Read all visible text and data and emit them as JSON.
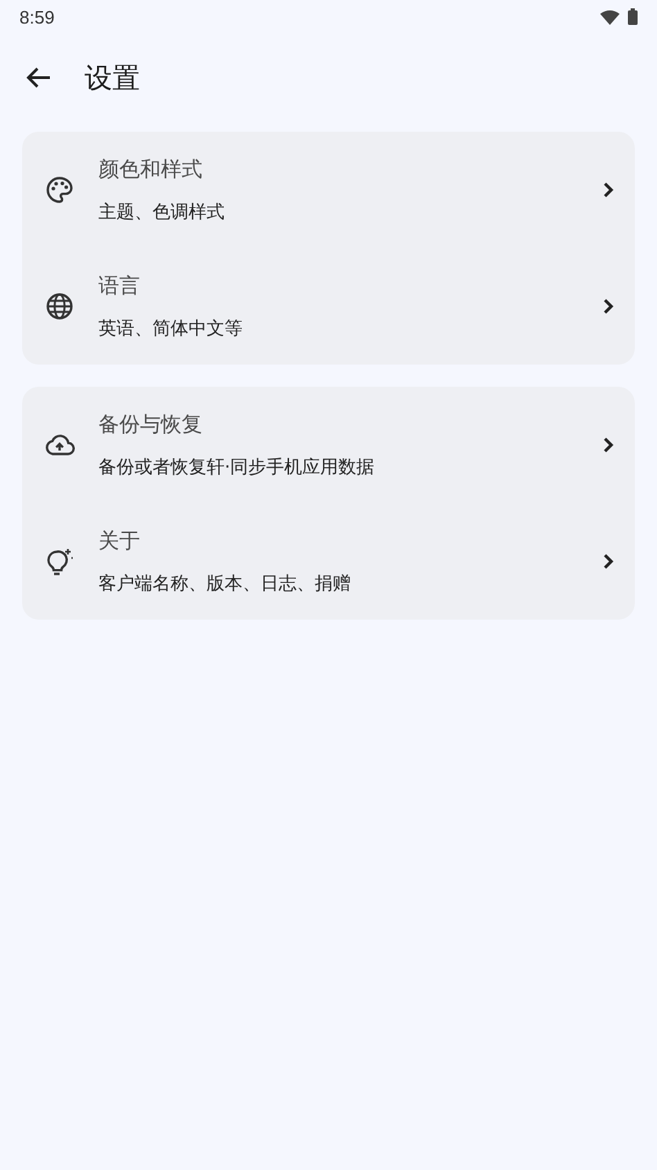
{
  "status_bar": {
    "time": "8:59"
  },
  "header": {
    "title": "设置"
  },
  "groups": [
    {
      "items": [
        {
          "title": "颜色和样式",
          "subtitle": "主题、色调样式"
        },
        {
          "title": "语言",
          "subtitle": "英语、简体中文等"
        }
      ]
    },
    {
      "items": [
        {
          "title": "备份与恢复",
          "subtitle": "备份或者恢复轩·同步手机应用数据"
        },
        {
          "title": "关于",
          "subtitle": "客户端名称、版本、日志、捐赠"
        }
      ]
    }
  ]
}
